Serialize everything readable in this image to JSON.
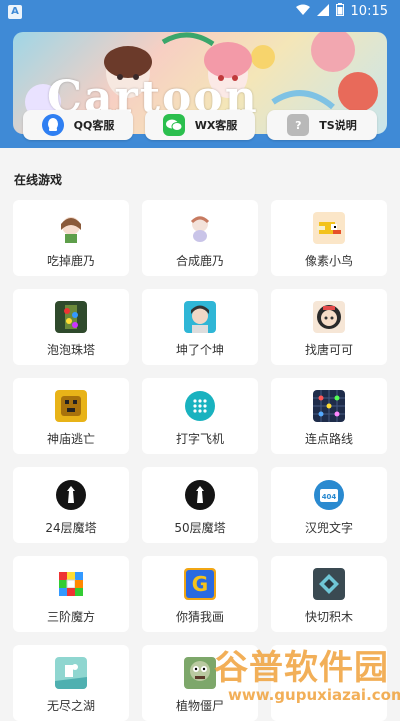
{
  "status_bar": {
    "notif_icon": "A",
    "time": "10:15"
  },
  "banner": {
    "title": "Cartoon"
  },
  "service_buttons": [
    {
      "label": "QQ客服",
      "icon": "qq-icon",
      "color": "#2f7ff2"
    },
    {
      "label": "WX客服",
      "icon": "wechat-icon",
      "color": "#2bbf4e"
    },
    {
      "label": "TS说明",
      "icon": "question-icon",
      "color": "#b9b9b9"
    }
  ],
  "section_title": "在线游戏",
  "games": [
    {
      "name": "吃掉鹿乃",
      "icon": "kano-girl-icon"
    },
    {
      "name": "合成鹿乃",
      "icon": "kano-chibi-icon"
    },
    {
      "name": "像素小鸟",
      "icon": "pixel-bird-icon"
    },
    {
      "name": "泡泡珠塔",
      "icon": "bubble-tower-icon"
    },
    {
      "name": "坤了个坤",
      "icon": "kun-portrait-icon"
    },
    {
      "name": "找唐可可",
      "icon": "tang-keke-icon"
    },
    {
      "name": "神庙逃亡",
      "icon": "temple-run-icon"
    },
    {
      "name": "打字飞机",
      "icon": "keypad-icon"
    },
    {
      "name": "连点路线",
      "icon": "dot-grid-icon"
    },
    {
      "name": "24层魔塔",
      "icon": "tower-icon"
    },
    {
      "name": "50层魔塔",
      "icon": "tower-icon"
    },
    {
      "name": "汉兜文字",
      "icon": "404-icon"
    },
    {
      "name": "三阶魔方",
      "icon": "rubik-cube-icon"
    },
    {
      "name": "你猜我画",
      "icon": "g-logo-icon"
    },
    {
      "name": "快切积木",
      "icon": "block-icon"
    },
    {
      "name": "无尽之湖",
      "icon": "lake-icon"
    },
    {
      "name": "植物僵尸",
      "icon": "zombie-icon"
    },
    {
      "name": "",
      "icon": ""
    }
  ],
  "watermark": {
    "main": "谷普软件园",
    "sub": "www.gupuxiazai.com"
  }
}
